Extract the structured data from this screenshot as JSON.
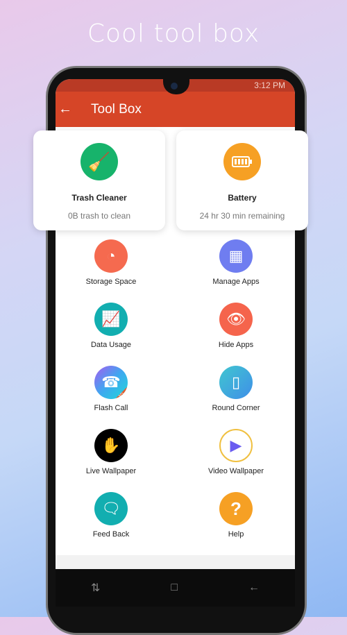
{
  "headline": "Cool tool box",
  "status": {
    "time": "3:12 PM"
  },
  "appbar": {
    "title": "Tool Box",
    "back_icon": "arrow-left-icon"
  },
  "cards": [
    {
      "title": "Trash Cleaner",
      "subtitle": "0B trash to clean",
      "icon": "broom-icon",
      "color": "#17b36b"
    },
    {
      "title": "Battery",
      "subtitle": "24 hr 30 min remaining",
      "icon": "battery-icon",
      "color": "#f6a024"
    }
  ],
  "tools": [
    {
      "label": "Storage Space",
      "icon": "pie-chart-icon",
      "color": "#f56a4f"
    },
    {
      "label": "Manage Apps",
      "icon": "apps-grid-icon",
      "color": "#6f7df0"
    },
    {
      "label": "Data Usage",
      "icon": "bar-chart-icon",
      "color": "#12aeb0"
    },
    {
      "label": "Hide Apps",
      "icon": "eye-off-icon",
      "color": "#f5644c"
    },
    {
      "label": "Flash Call",
      "icon": "phone-icon",
      "color": "#7b6cf0",
      "badge": "AD"
    },
    {
      "label": "Round Corner",
      "icon": "phone-frame-icon",
      "color": "#3eb1e0"
    },
    {
      "label": "Live Wallpaper",
      "icon": "hand-phone-icon",
      "color": "#000000"
    },
    {
      "label": "Video Wallpaper",
      "icon": "play-icon",
      "color": "#ffffff"
    },
    {
      "label": "Feed Back",
      "icon": "message-icon",
      "color": "#12aeb0"
    },
    {
      "label": "Help",
      "icon": "question-icon",
      "color": "#f6a024"
    }
  ]
}
